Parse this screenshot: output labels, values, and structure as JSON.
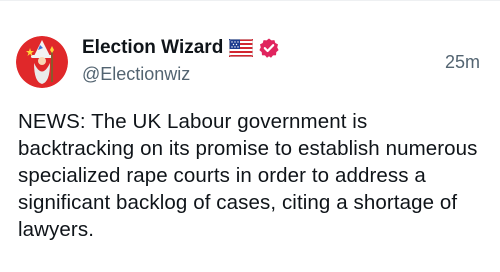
{
  "post": {
    "author": {
      "display_name": "Election Wizard",
      "handle": "@Electionwiz",
      "avatar_icon": "wizard-avatar-icon",
      "flag_icon": "us-flag-icon",
      "verified_icon": "verified-badge-icon",
      "verified_color": "#e0245e"
    },
    "timestamp": "25m",
    "text": "NEWS: The UK Labour government is backtracking on its promise to establish numerous specialized rape courts in order to address a significant backlog of cases, citing a shortage of lawyers.",
    "colors": {
      "avatar_background": "#e0282a",
      "text_primary": "#0f1419",
      "text_secondary": "#536471"
    }
  }
}
